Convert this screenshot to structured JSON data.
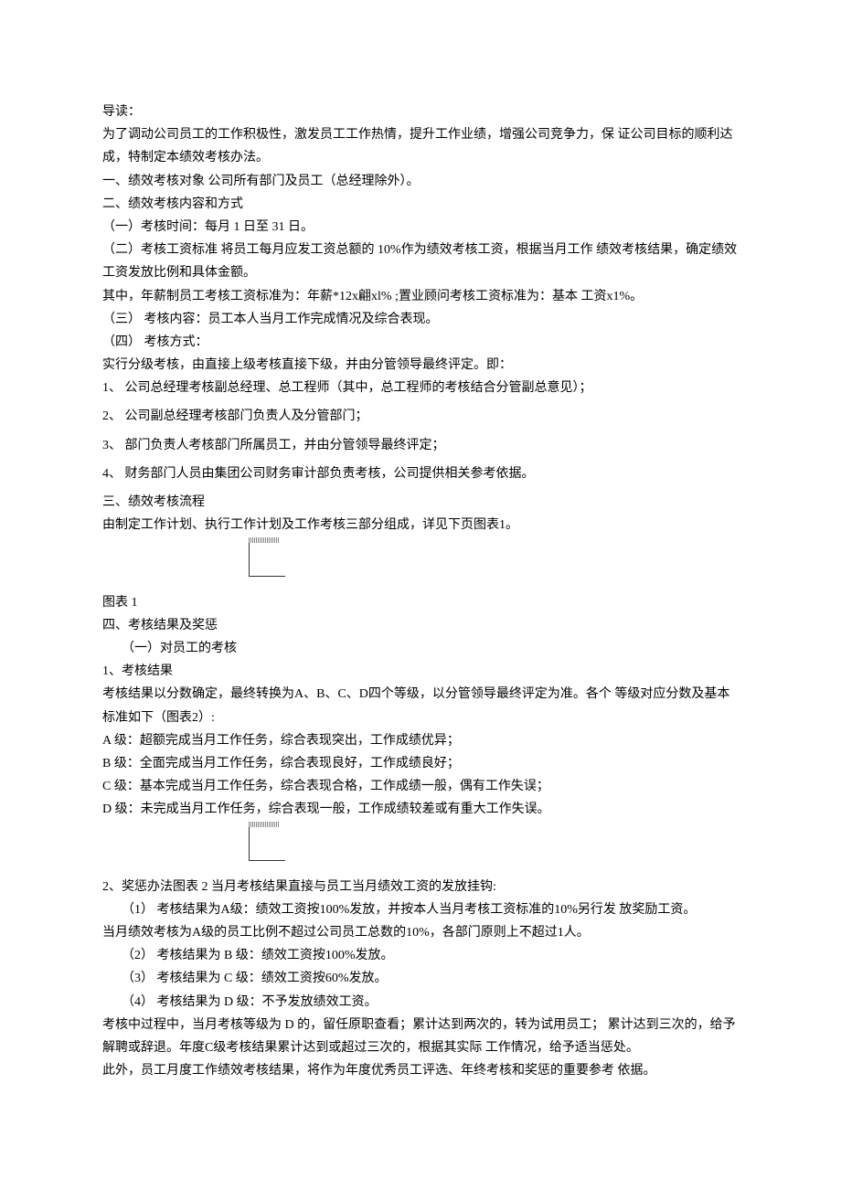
{
  "p01": "导读：",
  "p02": "为了调动公司员工的工作积极性，激发员工工作热情，提升工作业绩，增强公司竞争力，保 证公司目标的顺利达成，特制定本绩效考核办法。",
  "p03": "一、绩效考核对象 公司所有部门及员工（总经理除外）。",
  "p04": "二、绩效考核内容和方式",
  "p05": "（一）考核时间：每月 1 日至 31 日。",
  "p06": "（二）考核工资标准 将员工每月应发工资总额的 10%作为绩效考核工资，根据当月工作 绩效考核结果，确定绩效工资发放比例和具体金额。",
  "p07": "其中，年薪制员工考核工资标准为：年薪*12x翩xl% ;置业顾问考核工资标准为：基本 工资x1%。",
  "p08": "（三）    考核内容：员工本人当月工作完成情况及综合表现。",
  "p09": "（四）    考核方式：",
  "p10": "实行分级考核，由直接上级考核直接下级，并由分管领导最终评定。即：",
  "p11": "1、 公司总经理考核副总经理、总工程师（其中，总工程师的考核结合分管副总意见）；",
  "p12": "2、    公司副总经理考核部门负责人及分管部门；",
  "p13": "3、    部门负责人考核部门所属员工，并由分管领导最终评定；",
  "p14": "4、    财务部门人员由集团公司财务审计部负责考核，公司提供相关参考依据。",
  "p15": "三、绩效考核流程",
  "p16": "由制定工作计划、执行工作计划及工作考核三部分组成，详见下页图表1。",
  "p17": "图表 1",
  "p18": "四、考核结果及奖惩",
  "p19": "（一）对员工的考核",
  "p20": "1、考核结果",
  "p21": "考核结果以分数确定，最终转换为A、B、C、D四个等级，以分管领导最终评定为准。各个 等级对应分数及基本标准如下（图表2）:",
  "p22": "A 级：超额完成当月工作任务，综合表现突出，工作成绩优异；",
  "p23": "B 级：全面完成当月工作任务，综合表现良好，工作成绩良好；",
  "p24": "C 级：基本完成当月工作任务，综合表现合格，工作成绩一般，偶有工作失误；",
  "p25": "D 级：未完成当月工作任务，综合表现一般，工作成绩较差或有重大工作失误。",
  "p26": "2、奖惩办法图表 2 当月考核结果直接与员工当月绩效工资的发放挂钩:",
  "p27": "（1）    考核结果为A级：绩效工资按100%发放，并按本人当月考核工资标准的10%另行发 放奖励工资。",
  "p28": "当月绩效考核为A级的员工比例不超过公司员工总数的10%，各部门原则上不超过1人。",
  "p29": "（2）    考核结果为 B 级：绩效工资按100%发放。",
  "p30": "（3）    考核结果为 C 级：绩效工资按60%发放。",
  "p31": "（4）    考核结果为 D 级：不予发放绩效工资。",
  "p32": "考核中过程中，当月考核等级为 D 的，留任原职查看；累计达到两次的，转为试用员工； 累计达到三次的，给予解聘或辞退。年度C级考核结果累计达到或超过三次的，根据其实际 工作情况，给予适当惩处。",
  "p33": "此外，员工月度工作绩效考核结果，将作为年度优秀员工评选、年终考核和奖惩的重要参考 依据。"
}
